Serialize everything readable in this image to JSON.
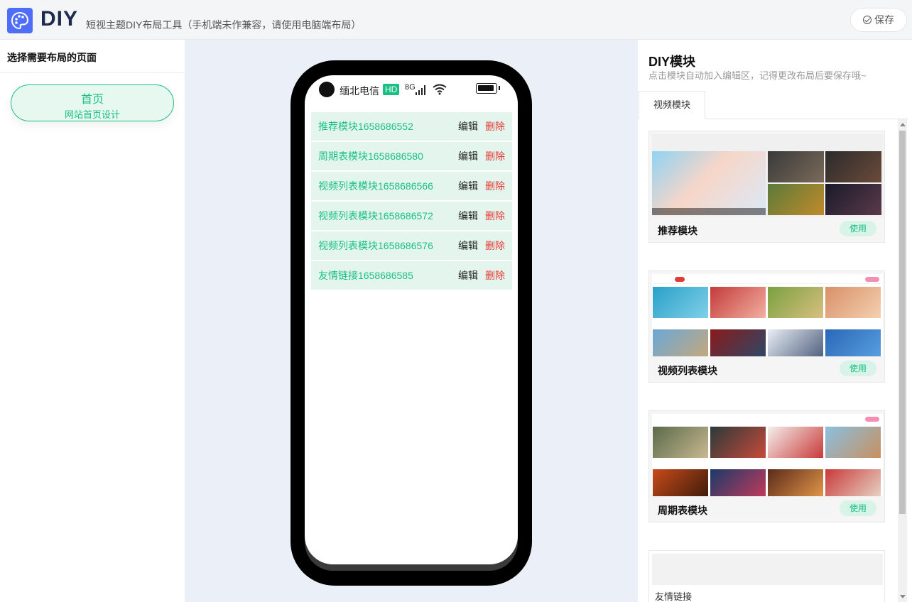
{
  "header": {
    "brand": "DIY",
    "subtitle": "短视主题DIY布局工具（手机端未作兼容，请使用电脑端布局）",
    "save_label": "保存"
  },
  "left": {
    "title": "选择需要布局的页面",
    "pages": [
      {
        "name": "首页",
        "desc": "网站首页设计"
      }
    ]
  },
  "phone": {
    "carrier": "缅北电信",
    "hd": "HD",
    "network": "8G",
    "modules": [
      {
        "name": "推荐模块1658686552",
        "edit": "编辑",
        "delete": "删除"
      },
      {
        "name": "周期表模块1658686580",
        "edit": "编辑",
        "delete": "删除"
      },
      {
        "name": "视频列表模块1658686566",
        "edit": "编辑",
        "delete": "删除"
      },
      {
        "name": "视频列表模块1658686572",
        "edit": "编辑",
        "delete": "删除"
      },
      {
        "name": "视频列表模块1658686576",
        "edit": "编辑",
        "delete": "删除"
      },
      {
        "name": "友情链接1658686585",
        "edit": "编辑",
        "delete": "删除"
      }
    ]
  },
  "right": {
    "title": "DIY模块",
    "subtitle": "点击模块自动加入编辑区，记得更改布局后要保存哦~",
    "tabs": [
      "视频模块"
    ],
    "cards": [
      {
        "name": "推荐模块",
        "use": "使用"
      },
      {
        "name": "视频列表模块",
        "use": "使用"
      },
      {
        "name": "周期表模块",
        "use": "使用"
      },
      {
        "name": "友情链接"
      }
    ]
  },
  "colors": {
    "accent": "#19c085",
    "danger": "#e53935",
    "brand": "#4f6ef7"
  }
}
